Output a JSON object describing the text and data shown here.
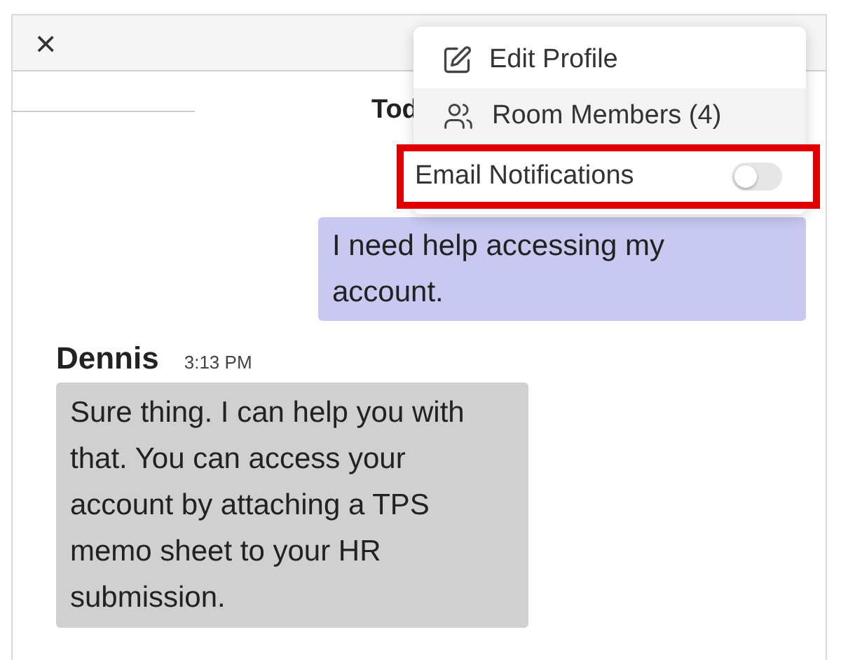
{
  "header": {
    "close_icon": "×"
  },
  "date_divider": {
    "label": "Tod"
  },
  "menu": {
    "items": [
      {
        "kind": "edit",
        "label": "Edit Profile",
        "hovered": false,
        "annotated": false
      },
      {
        "kind": "members",
        "label": "Room Members (4)",
        "hovered": true,
        "annotated": false
      },
      {
        "kind": "toggle",
        "label": "Email Notifications",
        "hovered": false,
        "annotated": true,
        "on": false
      }
    ]
  },
  "messages": [
    {
      "kind": "outgoing",
      "text": "I need help accessing my account."
    },
    {
      "kind": "incoming",
      "sender": "Dennis",
      "time": "3:13 PM",
      "text": "Sure thing. I can help you with that. You can access your account by attaching a TPS memo sheet to your HR submission."
    }
  ]
}
